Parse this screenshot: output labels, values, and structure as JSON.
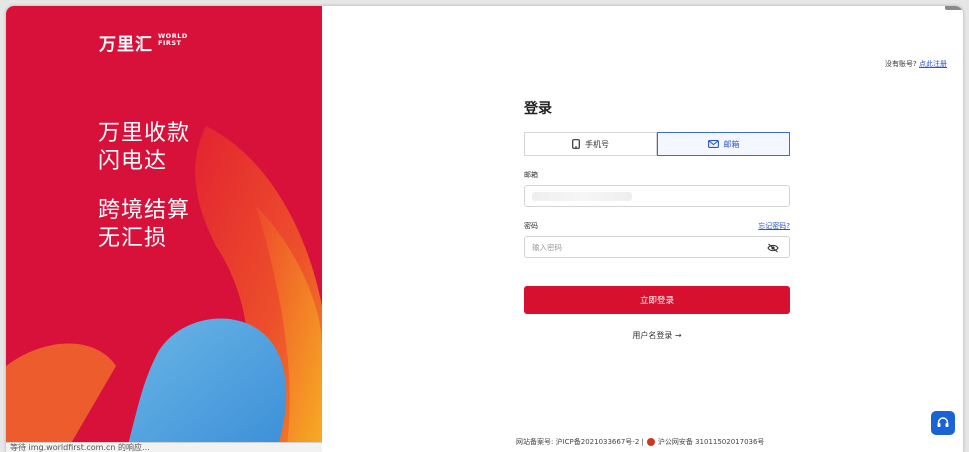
{
  "brand": {
    "logo_cn": "万里汇",
    "logo_en_line1": "WORLD",
    "logo_en_line2": "FIRST",
    "accent_color": "#d8113a"
  },
  "slogan": {
    "line1": "万里收款",
    "line2": "闪电达",
    "line3": "跨境结算",
    "line4": "无汇损"
  },
  "statusbar": {
    "text": "等待 img.worldfirst.com.cn 的响应..."
  },
  "header": {
    "no_account": "没有账号?",
    "register_link": "点此注册"
  },
  "login": {
    "title": "登录",
    "tabs": [
      {
        "label": "手机号",
        "icon": "phone-icon",
        "active": false
      },
      {
        "label": "邮箱",
        "icon": "mail-icon",
        "active": true
      }
    ],
    "email_label": "邮箱",
    "password_label": "密码",
    "forgot_link": "忘记密码?",
    "password_placeholder": "输入密码",
    "submit_label": "立即登录",
    "username_login": "用户名登录 →"
  },
  "footer": {
    "icp": "网站备案号: 沪ICP备2021033667号-2 |",
    "police": "沪公网安备 31011502017036号"
  },
  "icons": {
    "eye": "eye-off-icon",
    "support": "headset-icon"
  }
}
